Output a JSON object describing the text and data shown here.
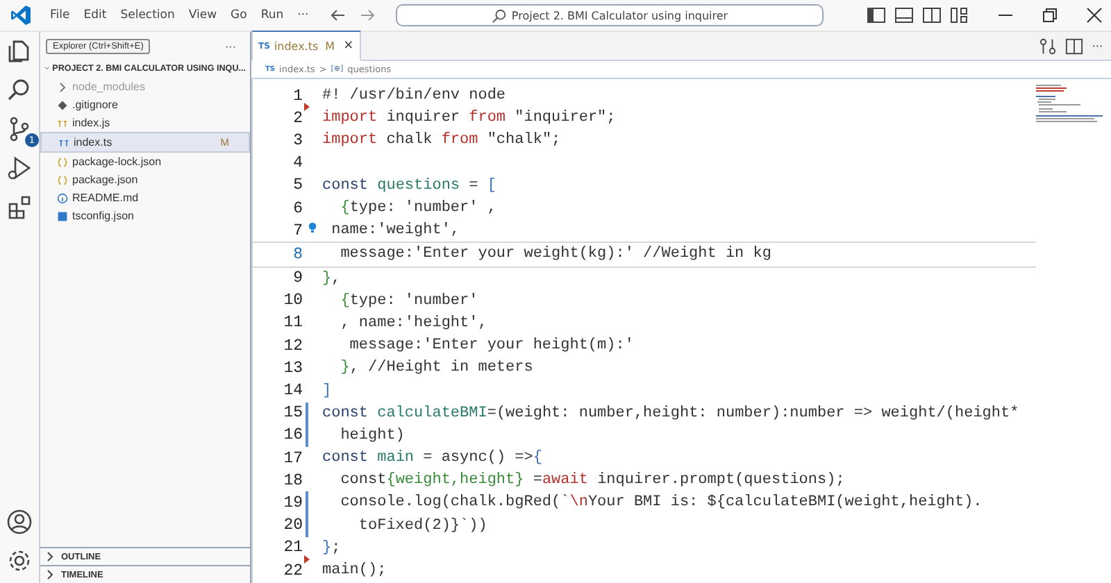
{
  "menu": [
    "File",
    "Edit",
    "Selection",
    "View",
    "Go",
    "Run",
    "···"
  ],
  "command_center": {
    "text": "Project 2. BMI Calculator using inquirer"
  },
  "activity_bar": {
    "source_control_badge": "1"
  },
  "sidebar": {
    "tooltip": "Explorer (Ctrl+Shift+E)",
    "more": "···",
    "project": "PROJECT 2. BMI CALCULATOR USING INQU...",
    "items": [
      {
        "name": "node_modules",
        "kind": "folder",
        "selected": false,
        "dim": true
      },
      {
        "name": ".gitignore",
        "kind": "git",
        "selected": false,
        "dim": false
      },
      {
        "name": "index.js",
        "kind": "js",
        "selected": false,
        "dim": false
      },
      {
        "name": "index.ts",
        "kind": "ts",
        "selected": true,
        "status": "M",
        "dim": false
      },
      {
        "name": "package-lock.json",
        "kind": "json",
        "selected": false,
        "dim": false
      },
      {
        "name": "package.json",
        "kind": "json",
        "selected": false,
        "dim": false
      },
      {
        "name": "README.md",
        "kind": "info",
        "selected": false,
        "dim": false
      },
      {
        "name": "tsconfig.json",
        "kind": "tsconfig",
        "selected": false,
        "dim": false
      }
    ],
    "sections": [
      "OUTLINE",
      "TIMELINE"
    ]
  },
  "tabs": [
    {
      "icon": "TS",
      "label": "index.ts",
      "status": "M",
      "close": "×",
      "selected": true
    }
  ],
  "breadcrumb": {
    "file_icon": "TS",
    "file": "index.ts",
    "separator": ">",
    "symbol_icon": "[⊕]",
    "symbol": "questions"
  },
  "editor": {
    "lines": [
      {
        "no": "1",
        "deleted_below": true,
        "tokens": [
          {
            "kind": "plain",
            "text": "#! /usr/bin/env node"
          }
        ]
      },
      {
        "no": "2",
        "tokens": [
          {
            "kind": "kw",
            "text": "import"
          },
          {
            "kind": "plain",
            "text": " inquirer "
          },
          {
            "kind": "kw",
            "text": "from"
          },
          {
            "kind": "str",
            "text": " \"inquirer\";"
          }
        ]
      },
      {
        "no": "3",
        "tokens": [
          {
            "kind": "kw",
            "text": "import"
          },
          {
            "kind": "plain",
            "text": " chalk "
          },
          {
            "kind": "kw",
            "text": "from"
          },
          {
            "kind": "str",
            "text": " \"chalk\";"
          }
        ]
      },
      {
        "no": "4"
      },
      {
        "no": "5",
        "tokens": [
          {
            "kind": "decl",
            "text": "const"
          },
          {
            "kind": "def",
            "text": " questions"
          },
          {
            "kind": "plain",
            "text": " = "
          },
          {
            "kind": "brace",
            "text": "["
          }
        ]
      },
      {
        "no": "6",
        "tokens": [
          {
            "kind": "brace2",
            "text": "  {"
          },
          {
            "kind": "plain",
            "text": "type: 'number' ,"
          }
        ]
      },
      {
        "no": "7",
        "lightbulb": true,
        "tokens": [
          {
            "kind": "plain",
            "text": " name:'weight',"
          }
        ]
      },
      {
        "no": "8",
        "current": true,
        "tokens": [
          {
            "kind": "plain",
            "text": "  message:'Enter your weight(kg):' //Weight in kg"
          }
        ]
      },
      {
        "no": "9",
        "tokens": [
          {
            "kind": "brace2",
            "text": "}"
          },
          {
            "kind": "plain",
            "text": ","
          }
        ]
      },
      {
        "no": "10",
        "tokens": [
          {
            "kind": "brace2",
            "text": "  {"
          },
          {
            "kind": "plain",
            "text": "type: 'number'"
          }
        ]
      },
      {
        "no": "11",
        "tokens": [
          {
            "kind": "plain",
            "text": "  , name:'height',"
          }
        ]
      },
      {
        "no": "12",
        "tokens": [
          {
            "kind": "plain",
            "text": "   message:'Enter your height(m):'"
          }
        ]
      },
      {
        "no": "13",
        "tokens": [
          {
            "kind": "brace2",
            "text": "  }"
          },
          {
            "kind": "plain",
            "text": ", //Height in meters"
          }
        ]
      },
      {
        "no": "14",
        "tokens": [
          {
            "kind": "brace",
            "text": "]"
          }
        ]
      },
      {
        "no": "15",
        "modified": true,
        "tokens": [
          {
            "kind": "decl",
            "text": "const"
          },
          {
            "kind": "def",
            "text": " calculateBMI"
          },
          {
            "kind": "plain",
            "text": "=(weight: number,height: number):number => weight/(height*"
          }
        ]
      },
      {
        "no": "16",
        "modified": true,
        "tokens": [
          {
            "kind": "plain",
            "text": "  height)"
          }
        ]
      },
      {
        "no": "17",
        "tokens": [
          {
            "kind": "decl",
            "text": "const"
          },
          {
            "kind": "def",
            "text": " main"
          },
          {
            "kind": "plain",
            "text": " = async() =>"
          },
          {
            "kind": "brace",
            "text": "{"
          }
        ]
      },
      {
        "no": "18",
        "tokens": [
          {
            "kind": "plain",
            "text": "  const"
          },
          {
            "kind": "brace2",
            "text": "{weight,height}"
          },
          {
            "kind": "plain",
            "text": " ="
          },
          {
            "kind": "kw",
            "text": "await"
          },
          {
            "kind": "plain",
            "text": " inquirer.prompt(questions);"
          }
        ]
      },
      {
        "no": "19",
        "modified": true,
        "tokens": [
          {
            "kind": "plain",
            "text": "  console.log(chalk.bgRed(`"
          },
          {
            "kind": "kw",
            "text": "\\n"
          },
          {
            "kind": "plain",
            "text": "Your BMI is: ${calculateBMI(weight,height)."
          }
        ]
      },
      {
        "no": "20",
        "modified": true,
        "tokens": [
          {
            "kind": "plain",
            "text": "    toFixed(2)}`))"
          }
        ]
      },
      {
        "no": "21",
        "deleted_below": true,
        "tokens": [
          {
            "kind": "brace",
            "text": "}"
          },
          {
            "kind": "plain",
            "text": ";"
          }
        ]
      },
      {
        "no": "22",
        "tokens": [
          {
            "kind": "plain",
            "text": "main();"
          }
        ]
      }
    ]
  }
}
